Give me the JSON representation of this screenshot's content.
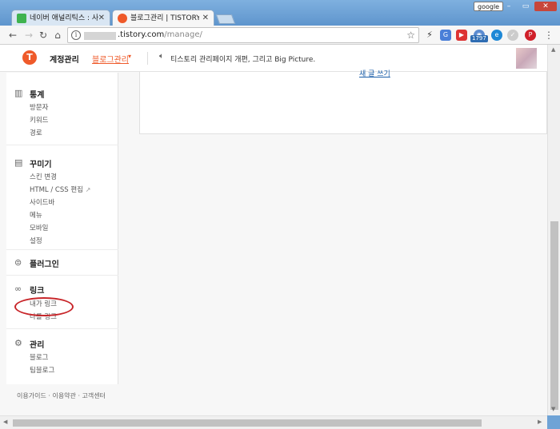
{
  "browser": {
    "tabs": [
      {
        "label": "네이버 애널리틱스 : 사이",
        "active": false,
        "favicon_color": "#3fb34f"
      },
      {
        "label": "블로그관리 | TISTORY",
        "active": true,
        "favicon_color": "#ef5a2a"
      }
    ],
    "account_label": "google",
    "url_domain": ".tistory.com",
    "url_path": "/manage/",
    "extension_badge": "1797",
    "window_buttons": [
      "–",
      "▭",
      "✕"
    ]
  },
  "header": {
    "logo_glyph": "T",
    "account_manage": "계정관리",
    "blog_manage": "블로그관리",
    "notice": "티스토리 관리페이지 개편, 그리고 Big Picture."
  },
  "content": {
    "card_link": "새 글 쓰기"
  },
  "sidebar": {
    "sections": [
      {
        "title": "통계",
        "icon": "bar-chart-icon",
        "items": [
          "방문자",
          "키워드",
          "경로"
        ]
      },
      {
        "title": "꾸미기",
        "icon": "layout-icon",
        "items": [
          "스킨 변경",
          "HTML / CSS 편집",
          "사이드바",
          "메뉴",
          "모바일",
          "설정"
        ]
      },
      {
        "title": "플러그인",
        "icon": "plugin-icon",
        "items": []
      },
      {
        "title": "링크",
        "icon": "link-icon",
        "items": [
          "내가 링크",
          "나를 링크"
        ]
      },
      {
        "title": "관리",
        "icon": "gear-icon",
        "items": [
          "블로그",
          "팀블로그"
        ]
      }
    ]
  },
  "footer": {
    "links": [
      "이용가이드",
      "이용약관",
      "고객센터"
    ],
    "separator": "·"
  },
  "colors": {
    "brand": "#ef5a2a",
    "highlight_circle": "#c8262a",
    "link": "#1b5ea8"
  }
}
